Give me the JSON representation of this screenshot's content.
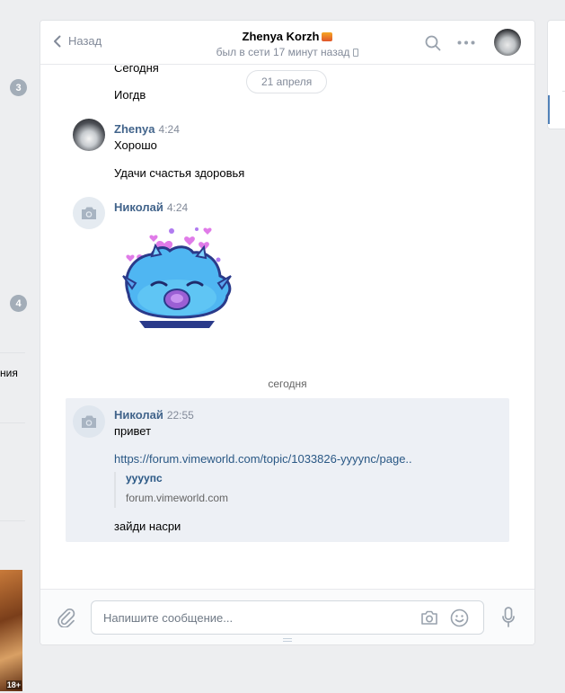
{
  "left_sidebar": {
    "badges": [
      "3",
      "4"
    ],
    "partial_text": "ния",
    "thumb_age_label": "18+"
  },
  "header": {
    "back_label": "Назад",
    "peer_name": "Zhenya Korzh",
    "peer_status": "был в сети 17 минут назад"
  },
  "messages": {
    "top_cut_text": "Сегодня",
    "date_pill": "21 апреля",
    "first_tail_text": "Иогдв",
    "groups": [
      {
        "author": "Zhenya",
        "time": "4:24",
        "texts": [
          "Хорошо",
          "Удачи счастья здоровья"
        ]
      },
      {
        "author": "Николай",
        "time": "4:24",
        "sticker": "blue-creature-hearts"
      }
    ],
    "day_separator": "сегодня",
    "last": {
      "author": "Николай",
      "time": "22:55",
      "text": "привет",
      "link": "https://forum.vimeworld.com/topic/1033826-yyyync/page..",
      "snippet_title": "уууупс",
      "snippet_domain": "forum.vimeworld.com",
      "text2": "зайди насри"
    }
  },
  "composer": {
    "placeholder": "Напишите сообщение..."
  },
  "colors": {
    "accent": "#2a5885",
    "author": "#42648b",
    "muted": "#828a99",
    "highlight": "#edf0f5"
  }
}
